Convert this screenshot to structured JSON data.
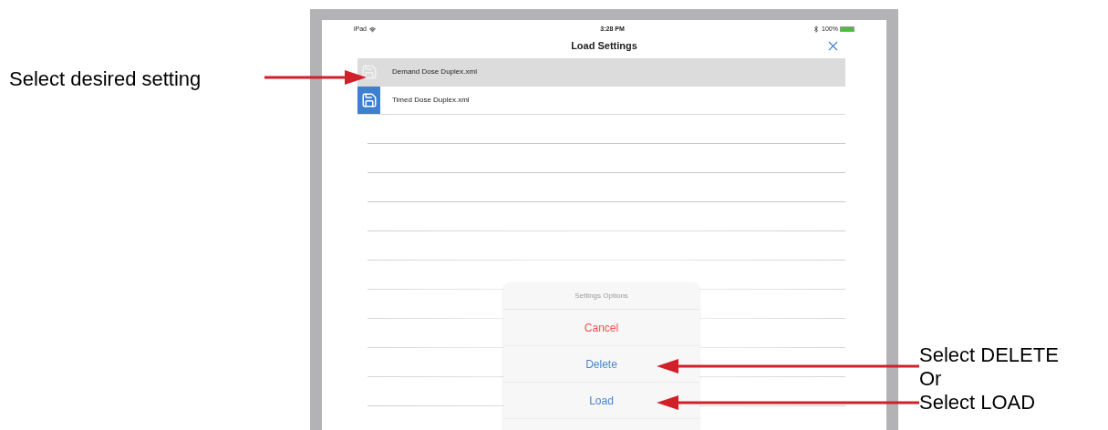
{
  "status_bar": {
    "device": "iPad",
    "time": "3:28 PM",
    "battery": "100%"
  },
  "header": {
    "title": "Load Settings"
  },
  "files": [
    {
      "name": "Demand Dose Duplex.xml",
      "selected": true
    },
    {
      "name": "Timed Dose Duplex.xml",
      "selected": false
    }
  ],
  "action_sheet": {
    "title": "Settings Options",
    "actions": [
      {
        "label": "Cancel",
        "kind": "destructive"
      },
      {
        "label": "Delete",
        "kind": "default"
      },
      {
        "label": "Load",
        "kind": "default"
      }
    ]
  },
  "annotations": [
    {
      "text": "Select desired setting"
    },
    {
      "text": "Select DELETE"
    },
    {
      "text": "Or"
    },
    {
      "text": "Select LOAD"
    }
  ]
}
